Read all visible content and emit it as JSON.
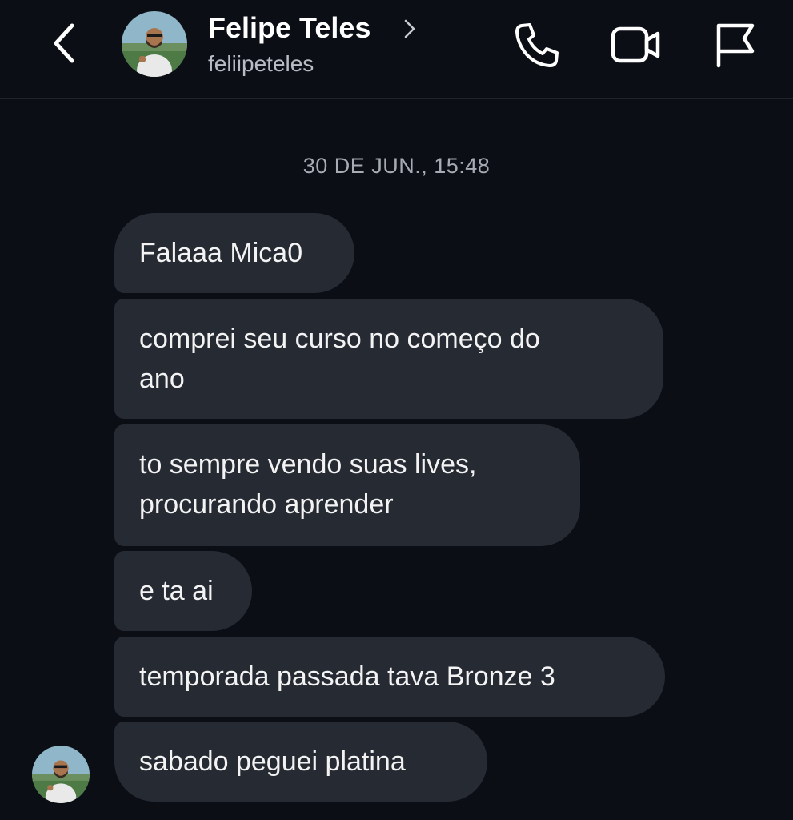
{
  "header": {
    "contact_name": "Felipe Teles",
    "username": "feliipeteles",
    "back_icon": "chevron-left-icon",
    "name_chevron_icon": "chevron-right-icon",
    "actions": [
      {
        "name": "call-button",
        "icon": "phone-icon"
      },
      {
        "name": "video-call-button",
        "icon": "video-camera-icon"
      },
      {
        "name": "report-button",
        "icon": "flag-icon"
      }
    ]
  },
  "thread": {
    "timestamp": "30 DE JUN., 15:48",
    "messages": [
      {
        "lines": [
          "Falaaa Mica0"
        ]
      },
      {
        "lines": [
          "comprei seu curso no começo do",
          "ano"
        ]
      },
      {
        "lines": [
          "to sempre vendo suas lives,",
          "procurando aprender"
        ]
      },
      {
        "lines": [
          "e ta ai"
        ]
      },
      {
        "lines": [
          "temporada passada tava Bronze 3"
        ]
      },
      {
        "lines": [
          "sabado peguei platina"
        ]
      }
    ]
  },
  "colors": {
    "background": "#0b0e15",
    "bubble": "#262a33",
    "text_primary": "#ffffff",
    "text_secondary": "#a7abb3"
  }
}
